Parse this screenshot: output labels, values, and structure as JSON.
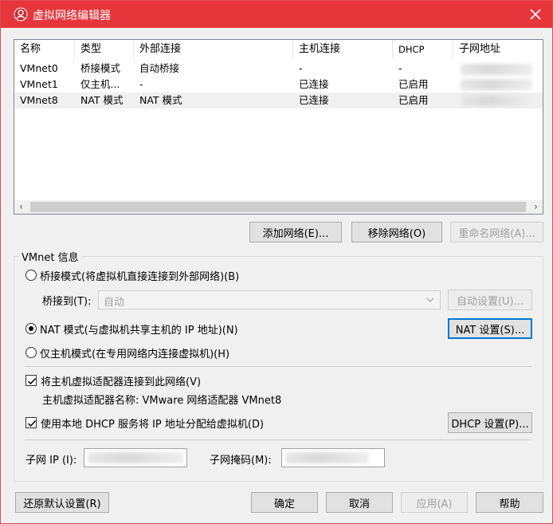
{
  "title": "虚拟网络编辑器",
  "icons": {
    "app": "app-icon",
    "close": "close-icon"
  },
  "table": {
    "columns": [
      "名称",
      "类型",
      "外部连接",
      "主机连接",
      "DHCP",
      "子网地址"
    ],
    "rows": [
      [
        "VMnet0",
        "桥接模式",
        "自动桥接",
        "-",
        "-",
        ""
      ],
      [
        "VMnet1",
        "仅主机...",
        "-",
        "已连接",
        "已启用",
        ""
      ],
      [
        "VMnet8",
        "NAT 模式",
        "NAT 模式",
        "已连接",
        "已启用",
        ""
      ]
    ],
    "selected_row": 2
  },
  "buttons": {
    "add_network": "添加网络(E)...",
    "remove_network": "移除网络(O)",
    "rename_network": "重命名网络(A)...",
    "auto_settings": "自动设置(U)...",
    "nat_settings": "NAT 设置(S)...",
    "dhcp_settings": "DHCP 设置(P)...",
    "restore_defaults": "还原默认设置(R)",
    "ok": "确定",
    "cancel": "取消",
    "apply": "应用(A)",
    "help": "帮助"
  },
  "vmnet_info": {
    "group_label": "VMnet 信息",
    "bridged_label": "桥接模式(将虚拟机直接连接到外部网络)(B)",
    "bridged_to_label": "桥接到(T):",
    "bridged_to_value": "自动",
    "nat_label": "NAT 模式(与虚拟机共享主机的 IP 地址)(N)",
    "host_only_label": "仅主机模式(在专用网络内连接虚拟机)(H)",
    "selected_mode": "nat",
    "connect_adapter_label": "将主机虚拟适配器连接到此网络(V)",
    "connect_adapter_checked": true,
    "adapter_name_label": "主机虚拟适配器名称: VMware 网络适配器 VMnet8",
    "use_dhcp_label": "使用本地 DHCP 服务将 IP 地址分配给虚拟机(D)",
    "use_dhcp_checked": true,
    "subnet_ip_label": "子网 IP (I):",
    "subnet_mask_label": "子网掩码(M):"
  },
  "colors": {
    "titlebar": "#e6363c",
    "focus": "#0078d7"
  }
}
